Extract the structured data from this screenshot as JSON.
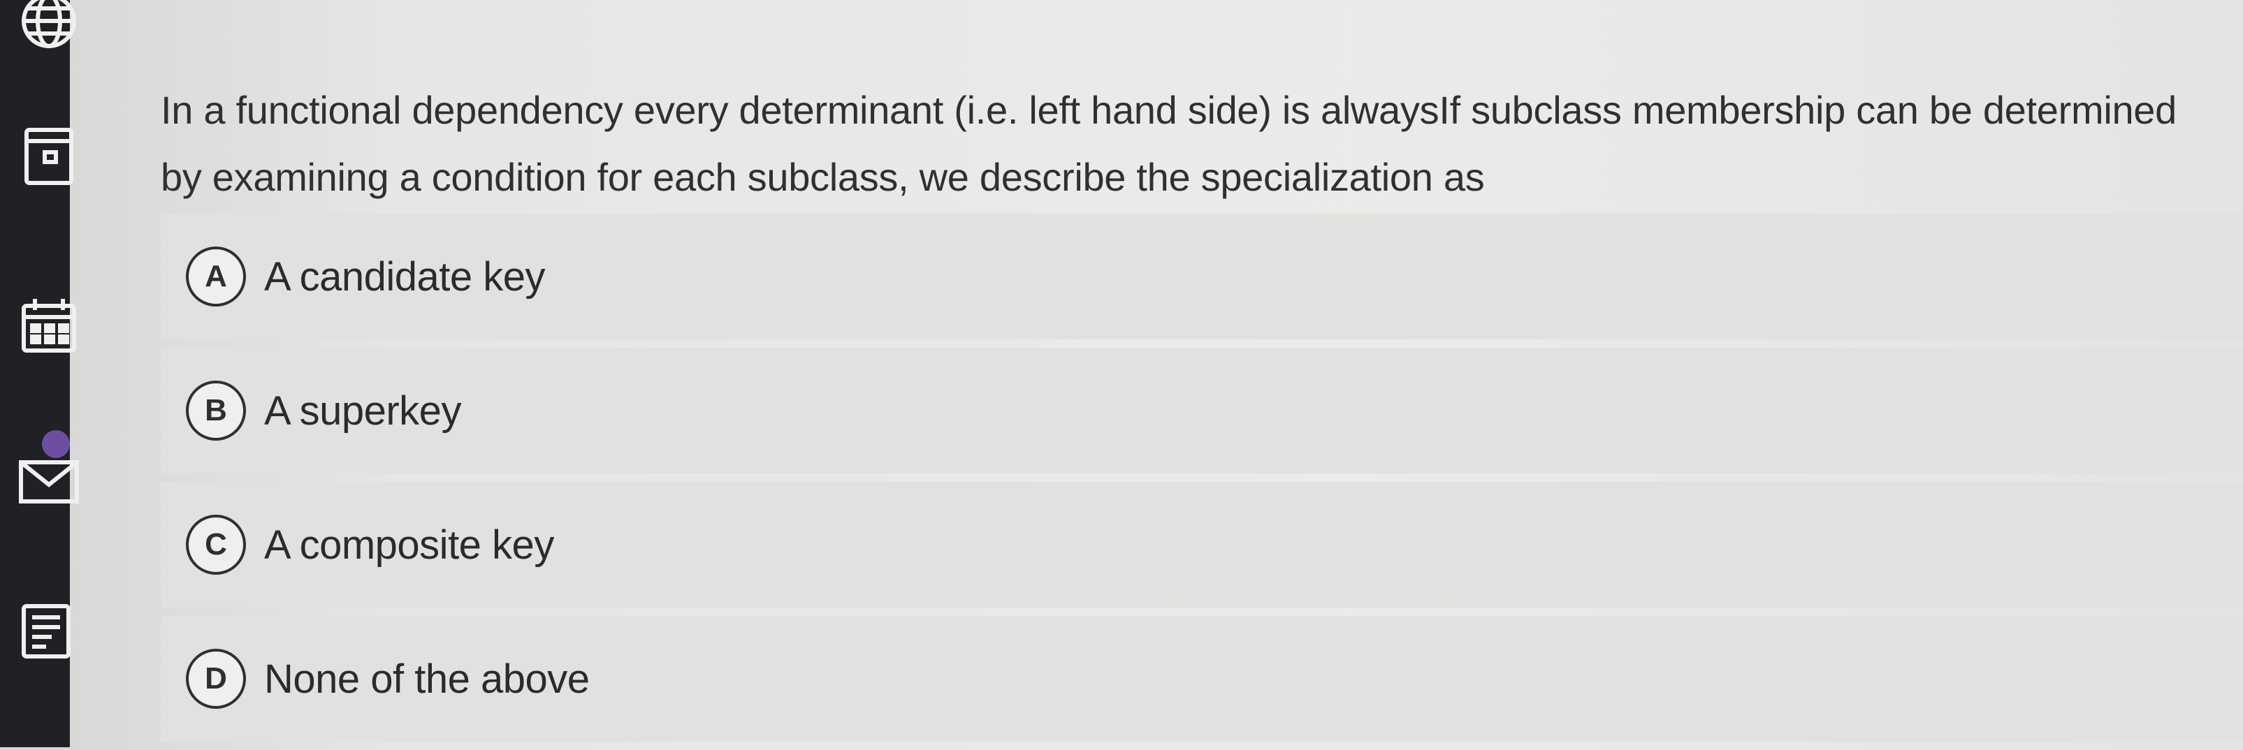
{
  "sidebar": {
    "icons": [
      {
        "name": "globe-icon"
      },
      {
        "name": "notebook-icon"
      },
      {
        "name": "calendar-icon"
      },
      {
        "name": "mail-icon"
      },
      {
        "name": "document-icon"
      }
    ],
    "badge_color": "#6e4ea3"
  },
  "question": {
    "text": "In a functional dependency every determinant (i.e. left hand side) is alwaysIf subclass membership can be determined by examining a condition for each subclass, we describe the specialization as"
  },
  "options": [
    {
      "letter": "A",
      "text": "A candidate key"
    },
    {
      "letter": "B",
      "text": "A superkey"
    },
    {
      "letter": "C",
      "text": "A composite key"
    },
    {
      "letter": "D",
      "text": "None of the above"
    }
  ]
}
